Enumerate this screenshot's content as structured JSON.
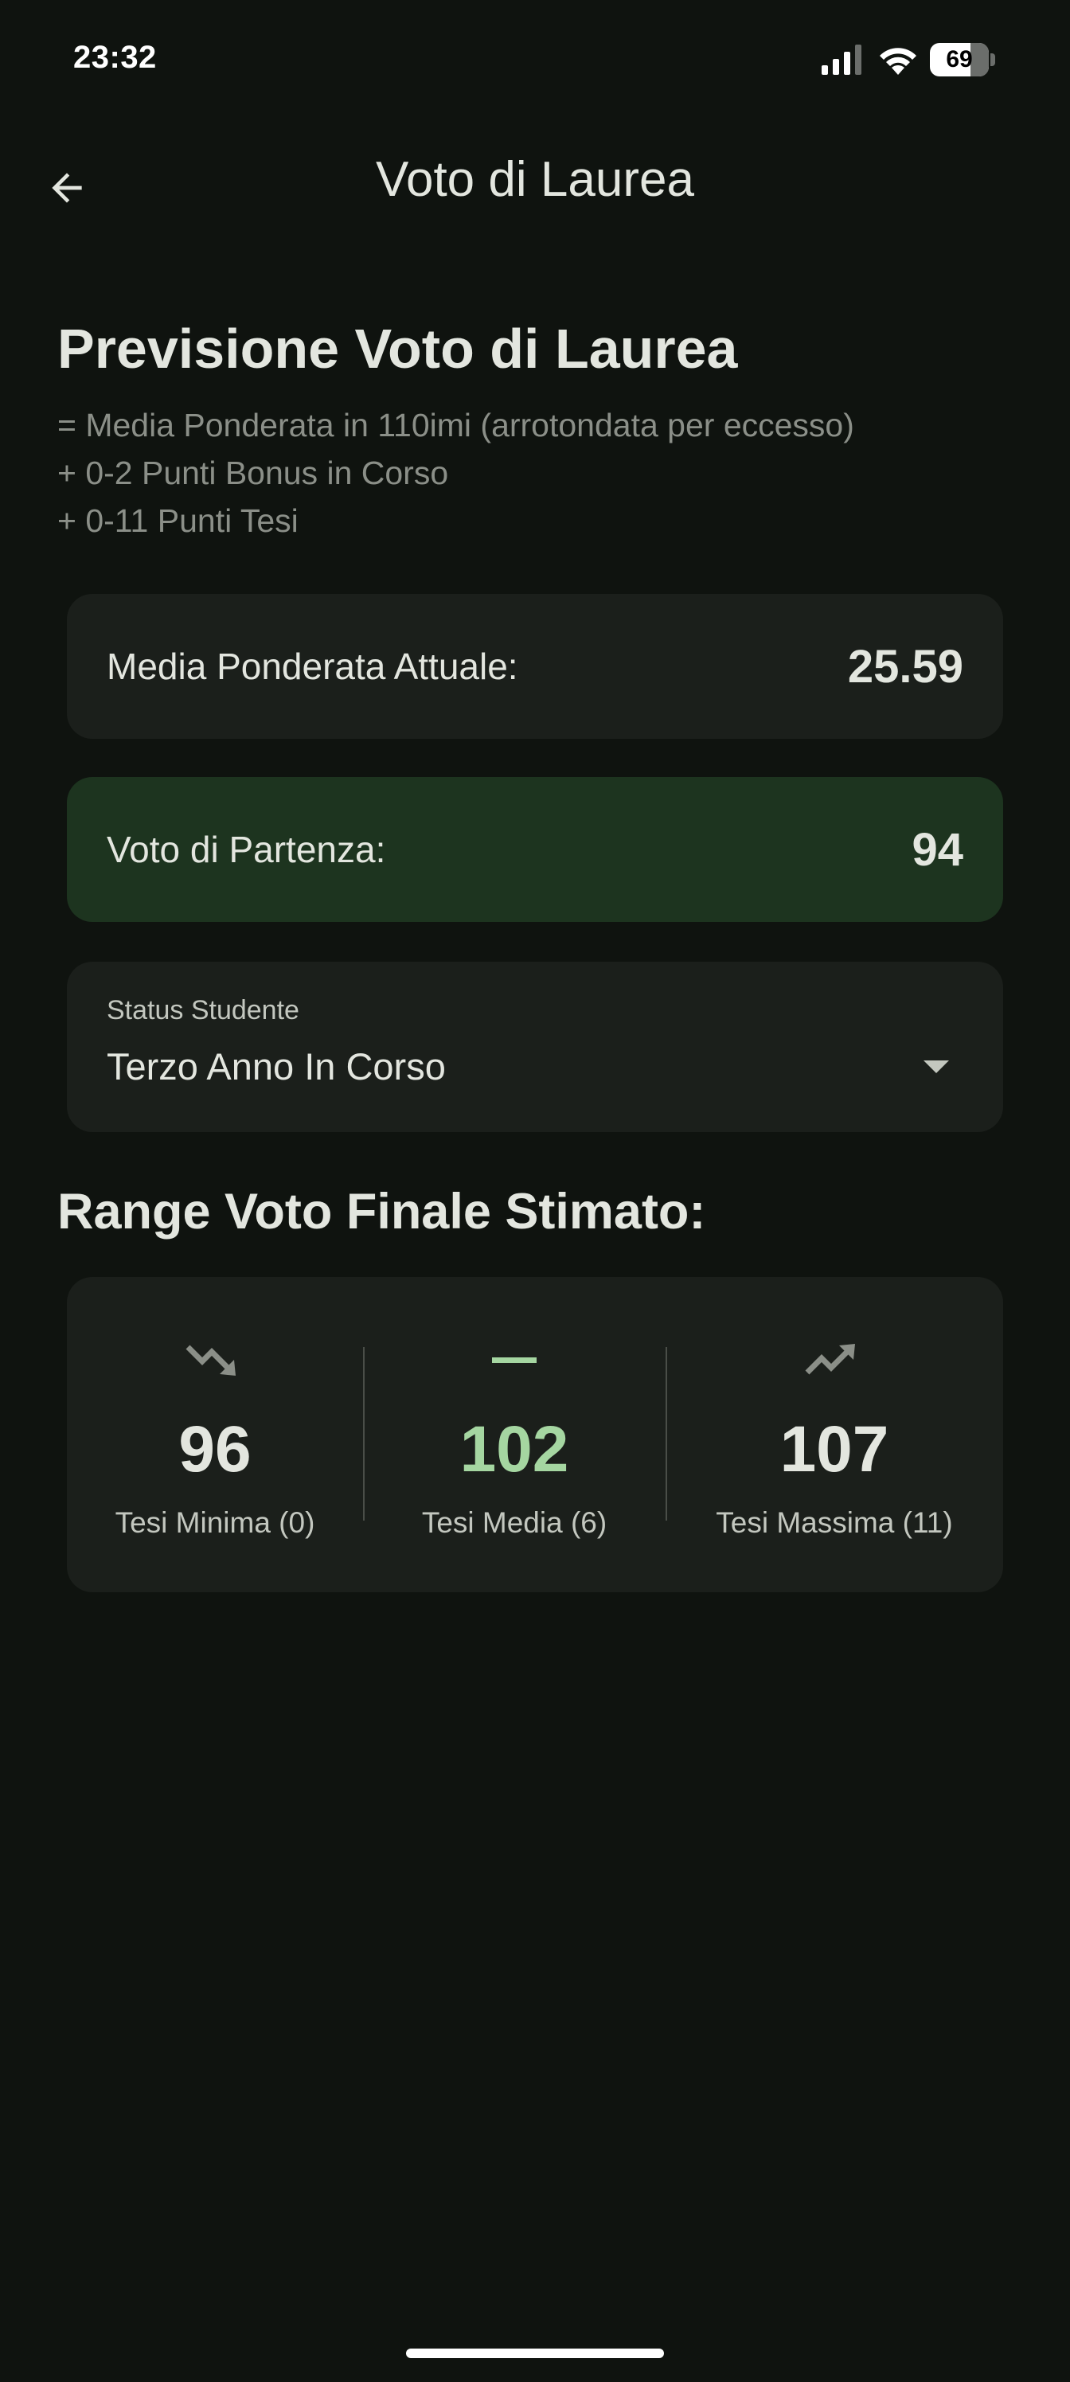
{
  "status_bar": {
    "time": "23:32",
    "battery": "69"
  },
  "app_bar": {
    "title": "Voto di Laurea",
    "back_icon": "arrow-left-icon"
  },
  "header": {
    "title": "Previsione Voto di Laurea",
    "formula": [
      "= Media Ponderata in 110imi (arrotondata per eccesso)",
      "+ 0-2 Punti Bonus in Corso",
      "+ 0-11 Punti Tesi"
    ]
  },
  "media_card": {
    "label": "Media Ponderata Attuale:",
    "value": "25.59"
  },
  "start_card": {
    "label": "Voto di Partenza:",
    "value": "94"
  },
  "status_dropdown": {
    "label": "Status Studente",
    "value": "Terzo Anno In Corso"
  },
  "range": {
    "title": "Range Voto Finale Stimato:",
    "items": [
      {
        "icon": "trending-down-icon",
        "value": "96",
        "caption": "Tesi Minima (0)"
      },
      {
        "icon": "remove-icon",
        "value": "102",
        "caption": "Tesi Media (6)"
      },
      {
        "icon": "trending-up-icon",
        "value": "107",
        "caption": "Tesi Massima (11)"
      }
    ]
  },
  "colors": {
    "background": "#0f130f",
    "card": "#1b1f1b",
    "start_card": "#1d341f",
    "accent": "#a5d6a1",
    "muted_text": "#8b8f88"
  }
}
